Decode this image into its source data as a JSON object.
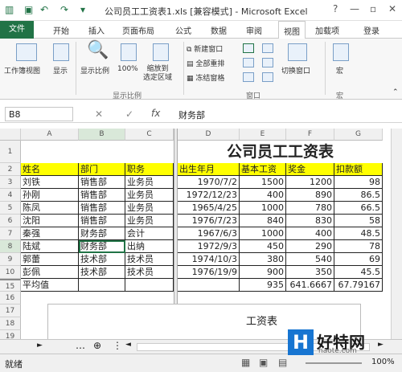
{
  "window": {
    "title": "公司员工工资表1.xls  [兼容模式] - Microsoft Excel",
    "help": "?",
    "minimize": "—",
    "restore": "▫",
    "close": "✕"
  },
  "tabs": {
    "file": "文件",
    "items": [
      "开始",
      "插入",
      "页面布局",
      "公式",
      "数据",
      "审阅",
      "视图",
      "加载项"
    ],
    "login": "登录"
  },
  "ribbon": {
    "workbook_views": "工作簿视图",
    "show": "显示",
    "zoom": "显示比例",
    "zoom100": "100%",
    "zoom_sel": "缩放到\n选定区域",
    "new_window": "新建窗口",
    "arrange_all": "全部重排",
    "freeze": "冻结窗格",
    "switch_window": "切换窗口",
    "macro": "宏",
    "group_zoom": "显示比例",
    "group_window": "窗口",
    "group_macro": "宏"
  },
  "formula_bar": {
    "name_box": "B8",
    "fx": "fx",
    "value": "财务部"
  },
  "columns": [
    "A",
    "B",
    "C",
    "D",
    "E",
    "F",
    "G"
  ],
  "rows": [
    "1",
    "2",
    "3",
    "4",
    "5",
    "6",
    "7",
    "8",
    "9",
    "10",
    "15",
    "16",
    "17",
    "18",
    "19"
  ],
  "sheet": {
    "title": "公司员工工资表",
    "headers": [
      "姓名",
      "部门",
      "职务",
      "出生年月",
      "基本工资",
      "奖金",
      "扣款额"
    ],
    "data": [
      [
        "刘铁",
        "销售部",
        "业务员",
        "1970/7/2",
        "1500",
        "1200",
        "98"
      ],
      [
        "孙刚",
        "销售部",
        "业务员",
        "1972/12/23",
        "400",
        "890",
        "86.5"
      ],
      [
        "陈凤",
        "销售部",
        "业务员",
        "1965/4/25",
        "1000",
        "780",
        "66.5"
      ],
      [
        "沈阳",
        "销售部",
        "业务员",
        "1976/7/23",
        "840",
        "830",
        "58"
      ],
      [
        "秦强",
        "财务部",
        "会计",
        "1967/6/3",
        "1000",
        "400",
        "48.5"
      ],
      [
        "陆斌",
        "财务部",
        "出纳",
        "1972/9/3",
        "450",
        "290",
        "78"
      ],
      [
        "郭蕾",
        "技术部",
        "技术员",
        "1974/10/3",
        "380",
        "540",
        "69"
      ],
      [
        "彭佩",
        "技术部",
        "技术员",
        "1976/19/9",
        "900",
        "350",
        "45.5"
      ]
    ],
    "row15": [
      "平均值",
      "",
      "",
      "",
      "935",
      "641.6667",
      "67.79167"
    ],
    "peek": [
      "1967"
    ]
  },
  "chart": {
    "title": "工资表"
  },
  "status": {
    "ready": "就绪",
    "zoom": "100%"
  },
  "watermark": {
    "mark": "H",
    "name": "好特网",
    "url": "haote.com"
  }
}
